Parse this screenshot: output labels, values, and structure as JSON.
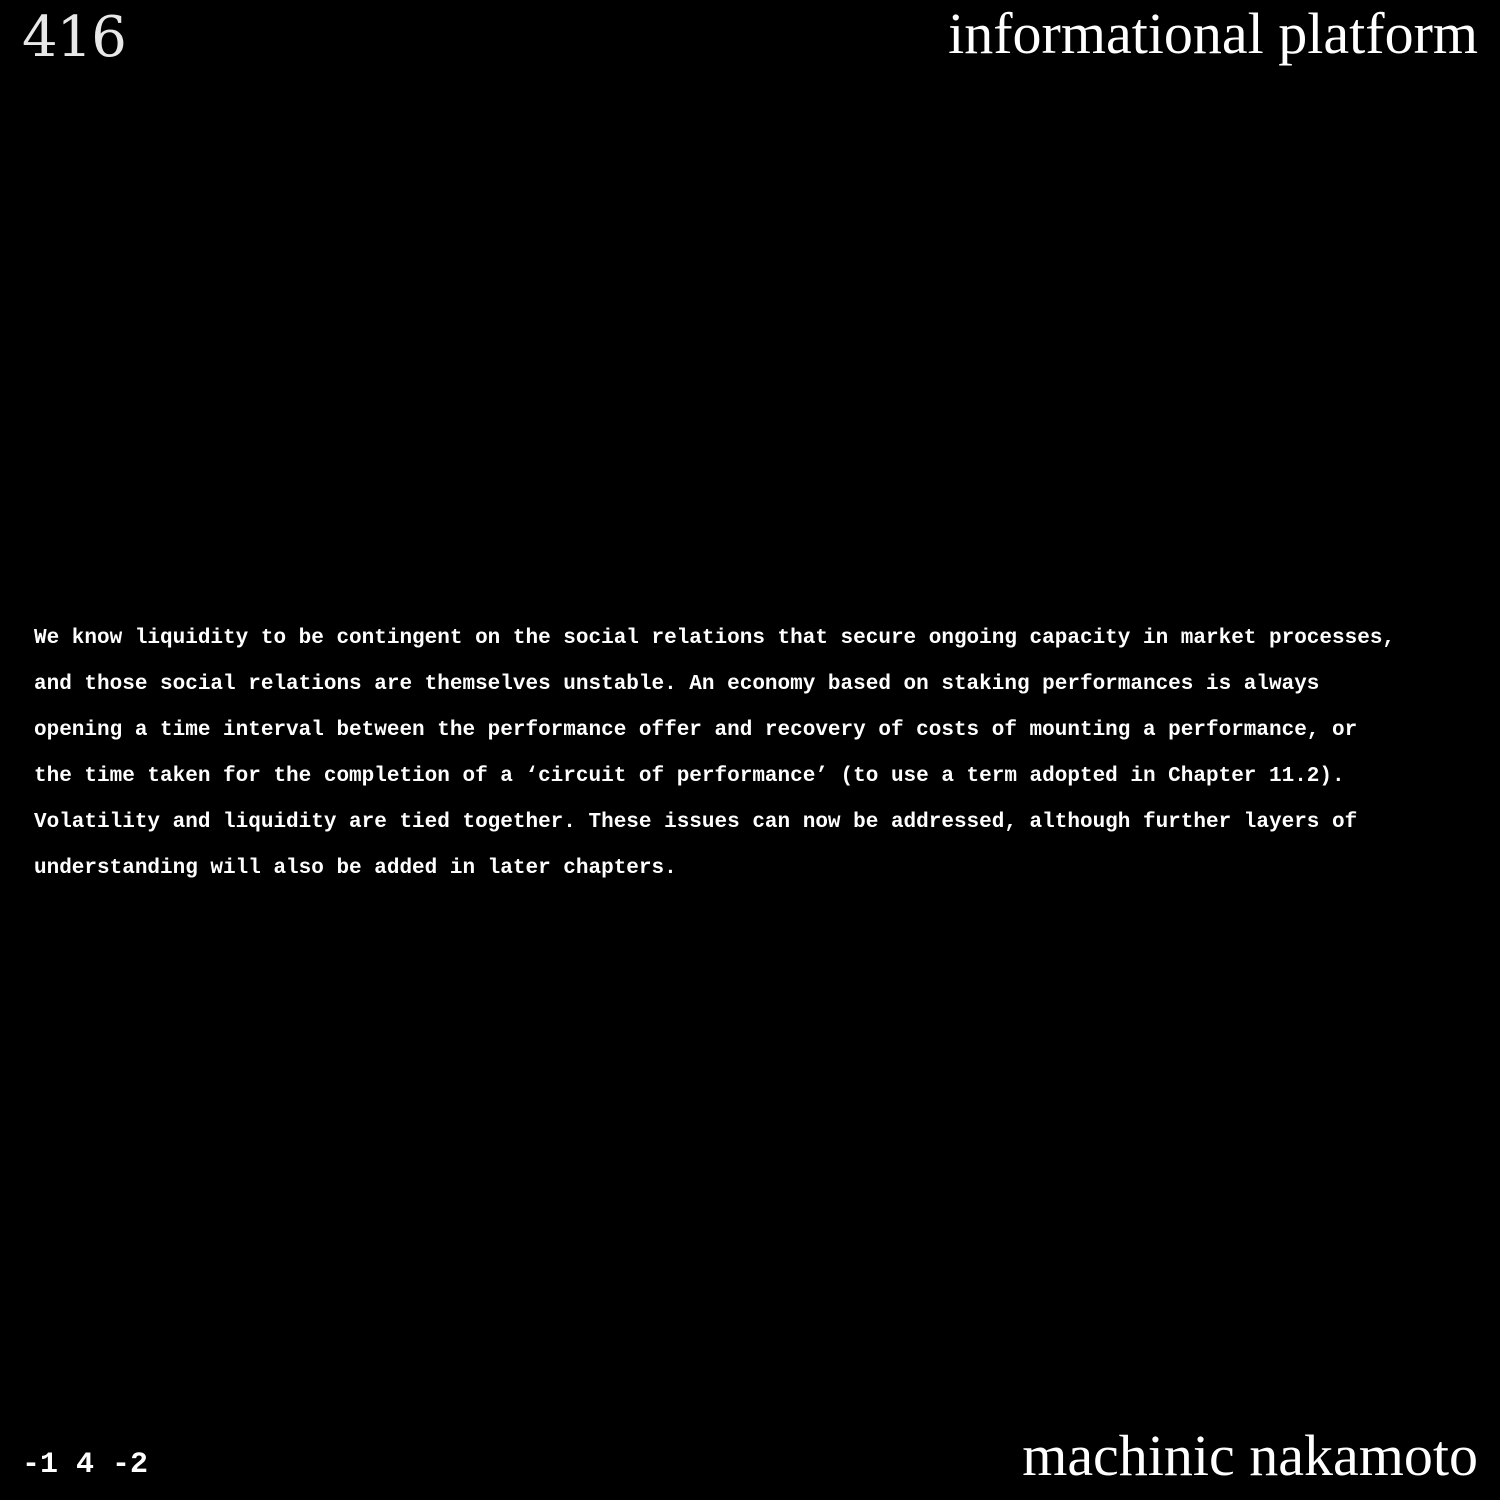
{
  "header": {
    "page_number": "416",
    "section_title": "informational platform"
  },
  "body": {
    "lines": [
      "We know liquidity to be contingent on the social relations that secure ongoing capacity in market processes,",
      "and those social relations are themselves unstable. An economy based on staking performances is always",
      "opening a time interval between the performance offer and recovery of costs of mounting a performance, or",
      "the time taken for the completion of a ‘circuit of performance’ (to use a term adopted in Chapter 11.2).",
      "Volatility and liquidity are tied together. These issues can now be addressed, although further layers of",
      "understanding will also be added in later chapters."
    ]
  },
  "footer": {
    "code": "-1 4 -2",
    "author": "machinic nakamoto"
  },
  "colors": {
    "background": "#000000",
    "text": "#ffffff"
  }
}
